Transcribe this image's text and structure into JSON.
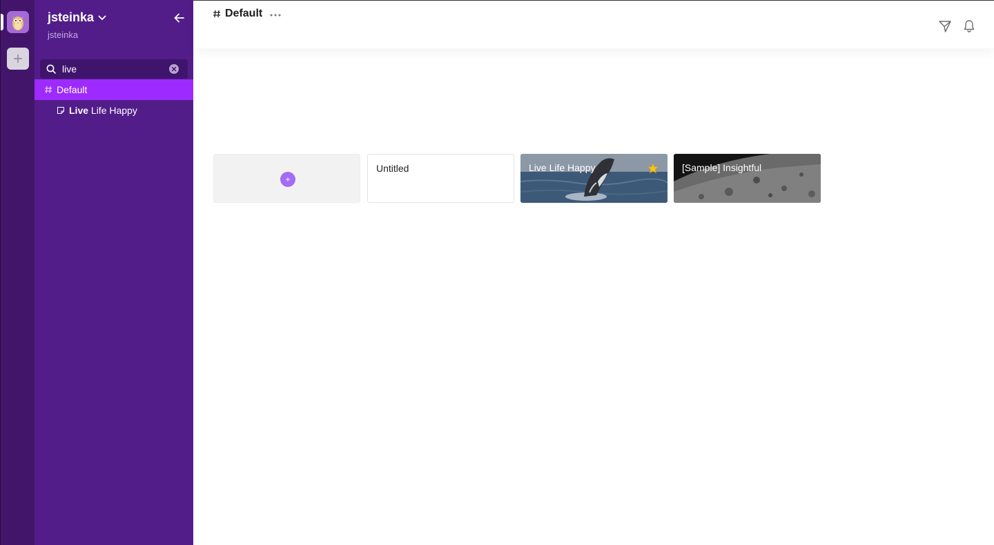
{
  "workspace": {
    "name": "jsteinka",
    "subtitle": "jsteinka"
  },
  "search": {
    "value": "live",
    "placeholder": "Search"
  },
  "sidebar": {
    "channel_label": "Default",
    "page": {
      "highlight": "Live",
      "rest": " Life Happy"
    }
  },
  "header": {
    "channel_title": "Default",
    "more_label": "···"
  },
  "cards": {
    "new_label": "+",
    "untitled": "Untitled",
    "live": "Live Life Happy",
    "sample": "[Sample] Insightful"
  },
  "colors": {
    "rail": "#42156b",
    "sidebar": "#521d89",
    "active_item": "#9d2bff",
    "add_button": "#a46bf5",
    "star": "#f5c518"
  },
  "icons": {
    "collapse": "arrow-left-icon",
    "search": "search-icon",
    "clear": "close-icon",
    "send": "send-icon",
    "bell": "bell-icon",
    "star": "star-icon"
  }
}
